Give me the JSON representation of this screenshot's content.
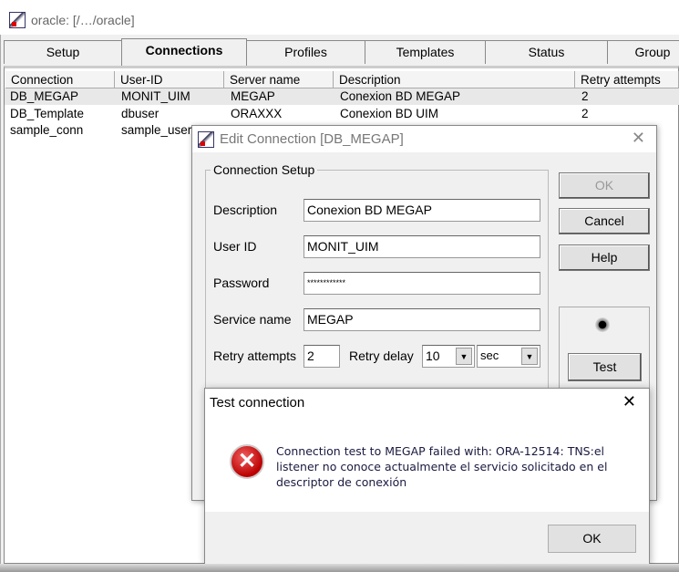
{
  "window": {
    "title": "oracle: [/…/oracle]"
  },
  "tabs": [
    "Setup",
    "Connections",
    "Profiles",
    "Templates",
    "Status",
    "Group"
  ],
  "table": {
    "headers": [
      "Connection",
      "User-ID",
      "Server name",
      "Description",
      "Retry attempts"
    ],
    "rows": [
      [
        "DB_MEGAP",
        "MONIT_UIM",
        "MEGAP",
        "Conexion BD MEGAP",
        "2"
      ],
      [
        "DB_Template",
        "dbuser",
        "ORAXXX",
        "Conexion BD UIM",
        "2"
      ],
      [
        "sample_conn",
        "sample_user",
        "",
        "",
        ""
      ]
    ]
  },
  "edit": {
    "title": "Edit Connection [DB_MEGAP]",
    "group": "Connection Setup",
    "description_label": "Description",
    "description": "Conexion BD MEGAP",
    "userid_label": "User ID",
    "userid": "MONIT_UIM",
    "password_label": "Password",
    "password": "************",
    "service_label": "Service name",
    "service": "MEGAP",
    "retry_label": "Retry attempts",
    "retry": "2",
    "delay_label": "Retry delay",
    "delay": "10",
    "unit": "sec",
    "ok": "OK",
    "cancel": "Cancel",
    "help": "Help",
    "test": "Test"
  },
  "msg": {
    "title": "Test connection",
    "text": "Connection test to MEGAP failed with: ORA-12514: TNS:el listener no conoce actualmente el servicio solicitado en el descriptor de conexión",
    "ok": "OK",
    "icon": "error-icon",
    "close": "✕"
  }
}
